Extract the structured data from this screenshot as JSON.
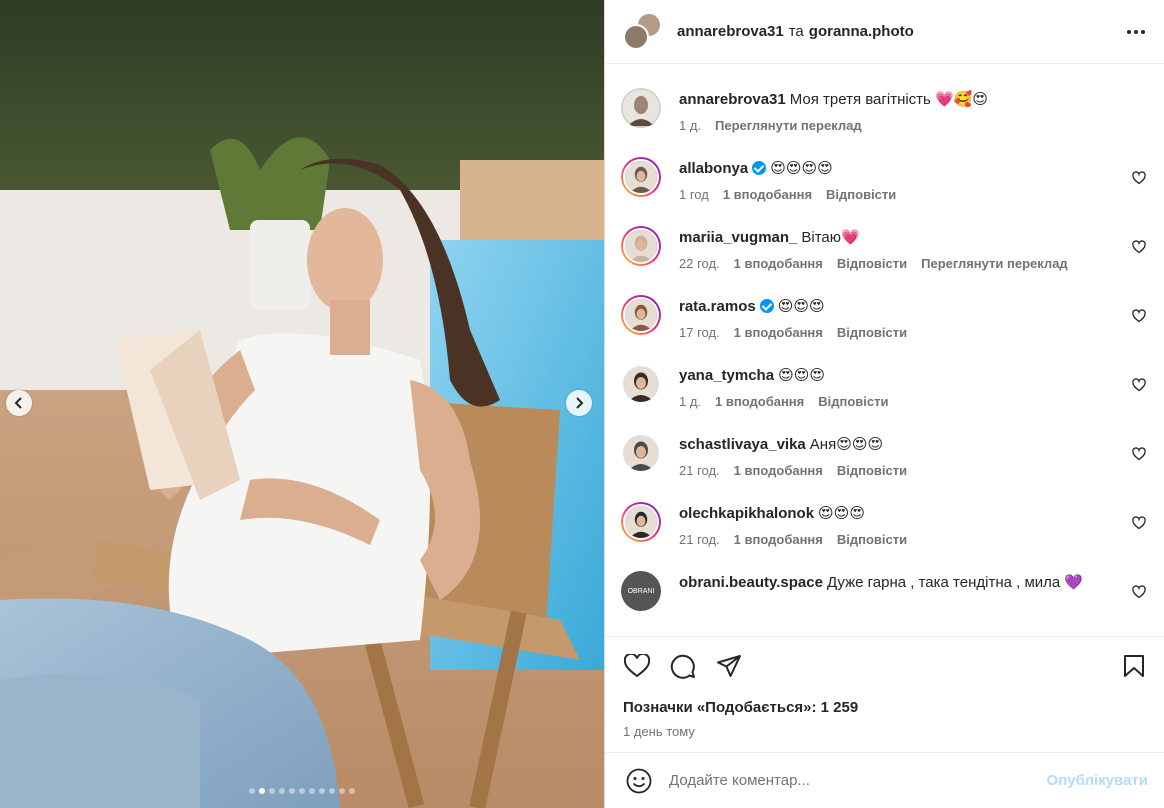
{
  "post": {
    "author": "annarebrova31",
    "collab_sep": "та",
    "collaborator": "goranna.photo",
    "caption": "Моя третя вагітність 💗🥰😍",
    "caption_time": "1 д.",
    "caption_translate": "Переглянути переклад",
    "carousel": {
      "count": 11,
      "active_index": 1
    }
  },
  "comments": [
    {
      "user": "allabonya",
      "verified": true,
      "text": "😍😍😍😍",
      "time": "1 год",
      "likes": "1 вподобання",
      "reply": "Відповісти",
      "translate": ""
    },
    {
      "user": "mariia_vugman_",
      "verified": false,
      "text": "Вітаю💗",
      "time": "22 год.",
      "likes": "1 вподобання",
      "reply": "Відповісти",
      "translate": "Переглянути переклад"
    },
    {
      "user": "rata.ramos",
      "verified": true,
      "text": "😍😍😍",
      "time": "17 год.",
      "likes": "1 вподобання",
      "reply": "Відповісти",
      "translate": ""
    },
    {
      "user": "yana_tymcha",
      "verified": false,
      "text": "😍😍😍",
      "time": "1 д.",
      "likes": "1 вподобання",
      "reply": "Відповісти",
      "translate": ""
    },
    {
      "user": "schastlivaya_vika",
      "verified": false,
      "text": "Аня😍😍😍",
      "time": "21 год.",
      "likes": "1 вподобання",
      "reply": "Відповісти",
      "translate": ""
    },
    {
      "user": "olechkapikhalonok",
      "verified": false,
      "text": "😍😍😍",
      "time": "21 год.",
      "likes": "1 вподобання",
      "reply": "Відповісти",
      "translate": ""
    },
    {
      "user": "obrani.beauty.space",
      "verified": false,
      "text": "Дуже гарна , така тендітна , мила 💜",
      "time": "",
      "likes": "",
      "reply": "",
      "translate": ""
    }
  ],
  "obrani_avatar_text": "OBRANI",
  "likes_label": "Позначки «Подобається»: 1 259",
  "posted_ago": "1 день тому",
  "comment_box": {
    "placeholder": "Додайте коментар...",
    "submit": "Опублікувати"
  },
  "icons": {
    "more": "more-horizontal-icon",
    "like": "heart-icon",
    "comment": "comment-icon",
    "share": "share-icon",
    "save": "bookmark-icon",
    "emoji": "emoji-icon",
    "prev": "chevron-left-icon",
    "next": "chevron-right-icon"
  },
  "colors": {
    "link_blue": "#0095f6",
    "post_disabled": "#b3dbff",
    "text": "#262626",
    "muted": "#737373"
  }
}
